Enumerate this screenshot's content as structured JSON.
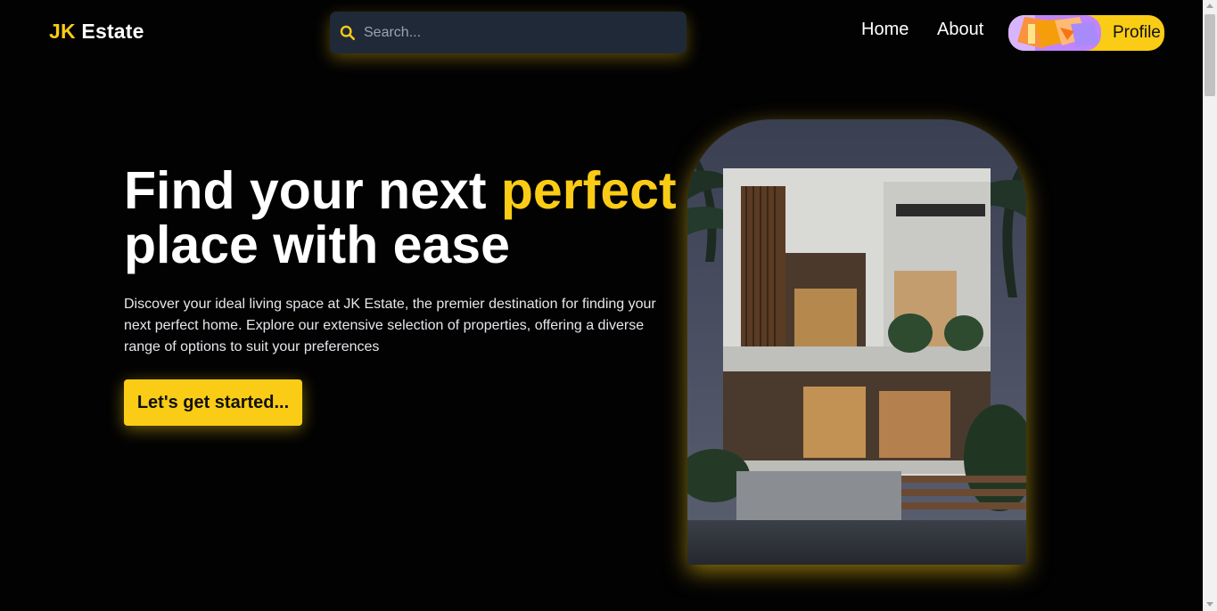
{
  "header": {
    "logo_accent": "JK",
    "logo_rest": "Estate",
    "search_placeholder": "Search...",
    "search_icon": "search-icon",
    "nav": [
      {
        "label": "Home"
      },
      {
        "label": "About"
      }
    ],
    "profile_label": "Profile"
  },
  "hero": {
    "title_part1": "Find your next ",
    "title_highlight": "perfect",
    "title_part2": "place with ease",
    "description": "Discover your ideal living space at JK Estate, the premier destination for finding your next perfect home. Explore our extensive selection of properties, offering a diverse range of options to suit your preferences",
    "cta_label": "Let's get started..."
  },
  "colors": {
    "accent": "#facc15",
    "background": "#000000",
    "search_bg": "#1f2937"
  }
}
